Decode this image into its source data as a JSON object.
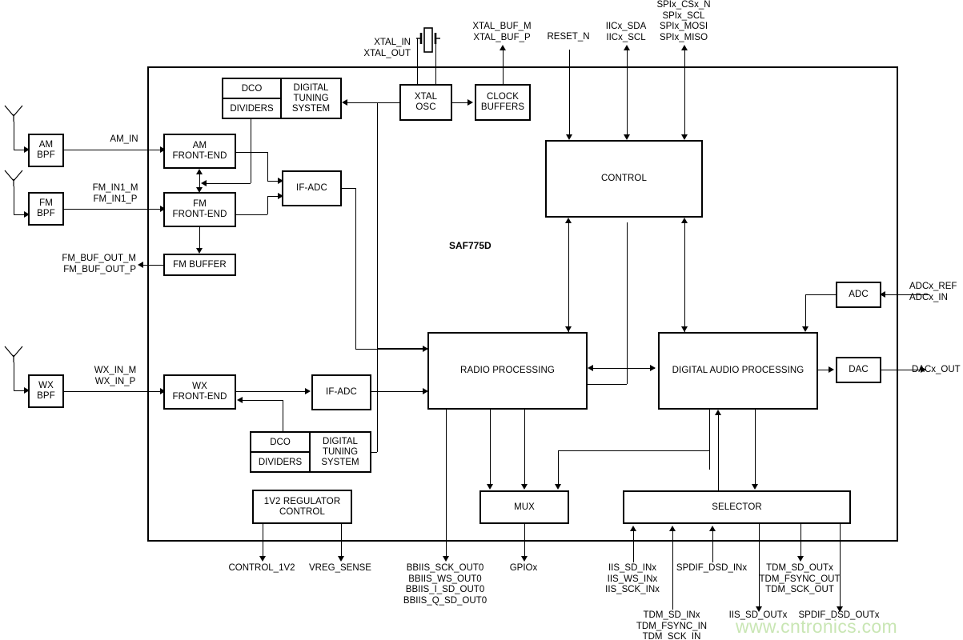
{
  "diagram": {
    "chip_name": "SAF775D",
    "watermark": "www.cntronics.com"
  },
  "blocks": {
    "am_bpf": "AM\nBPF",
    "fm_bpf": "FM\nBPF",
    "wx_bpf": "WX\nBPF",
    "am_front_end": "AM\nFRONT-END",
    "fm_front_end": "FM\nFRONT-END",
    "wx_front_end": "WX\nFRONT-END",
    "fm_buffer": "FM BUFFER",
    "if_adc_top": "IF-ADC",
    "if_adc_bottom": "IF-ADC",
    "dco_top": "DCO",
    "dividers_top": "DIVIDERS",
    "digital_tuning_top": "DIGITAL\nTUNING\nSYSTEM",
    "dco_bottom": "DCO",
    "dividers_bottom": "DIVIDERS",
    "digital_tuning_bottom": "DIGITAL\nTUNING\nSYSTEM",
    "xtal_osc": "XTAL\nOSC",
    "clock_buffers": "CLOCK\nBUFFERS",
    "control": "CONTROL",
    "radio_processing": "RADIO PROCESSING",
    "digital_audio_processing": "DIGITAL AUDIO PROCESSING",
    "adc": "ADC",
    "dac": "DAC",
    "mux": "MUX",
    "selector": "SELECTOR",
    "regulator": "1V2 REGULATOR\nCONTROL"
  },
  "signals": {
    "am_in": "AM_IN",
    "fm_in1": "FM_IN1_M\nFM_IN1_P",
    "wx_in": "WX_IN_M\nWX_IN_P",
    "fm_buf_out": "FM_BUF_OUT_M\nFM_BUF_OUT_P",
    "xtal_in_out": "XTAL_IN\nXTAL_OUT",
    "xtal_buf": "XTAL_BUF_M\nXTAL_BUF_P",
    "reset_n": "RESET_N",
    "iic": "IICx_SDA\nIICx_SCL",
    "spi": "SPIx_CSx_N\nSPIx_SCL\nSPIx_MOSI\nSPIx_MISO",
    "adc_in": "ADCx_REF\nADCx_IN",
    "dac_out": "DACx_OUT",
    "control_1v2": "CONTROL_1V2",
    "vreg_sense": "VREG_SENSE",
    "bbiis_out": "BBIIS_SCK_OUT0\nBBIIS_WS_OUT0\nBBIIS_I_SD_OUT0\nBBIIS_Q_SD_OUT0",
    "gpiox": "GPIOx",
    "iis_in": "IIS_SD_INx\nIIS_WS_INx\nIIS_SCK_INx",
    "spdif_dsd_in": "SPDIF_DSD_INx",
    "tdm_out": "TDM_SD_OUTx\nTDM_FSYNC_OUT\nTDM_SCK_OUT",
    "tdm_in": "TDM_SD_INx\nTDM_FSYNC_IN\nTDM_SCK_IN",
    "iis_sd_outx": "IIS_SD_OUTx",
    "spdif_dsd_outx": "SPDIF_DSD_OUTx"
  },
  "colors": {
    "line": "#000000",
    "background": "#ffffff",
    "watermark": "#c9e6b4"
  }
}
